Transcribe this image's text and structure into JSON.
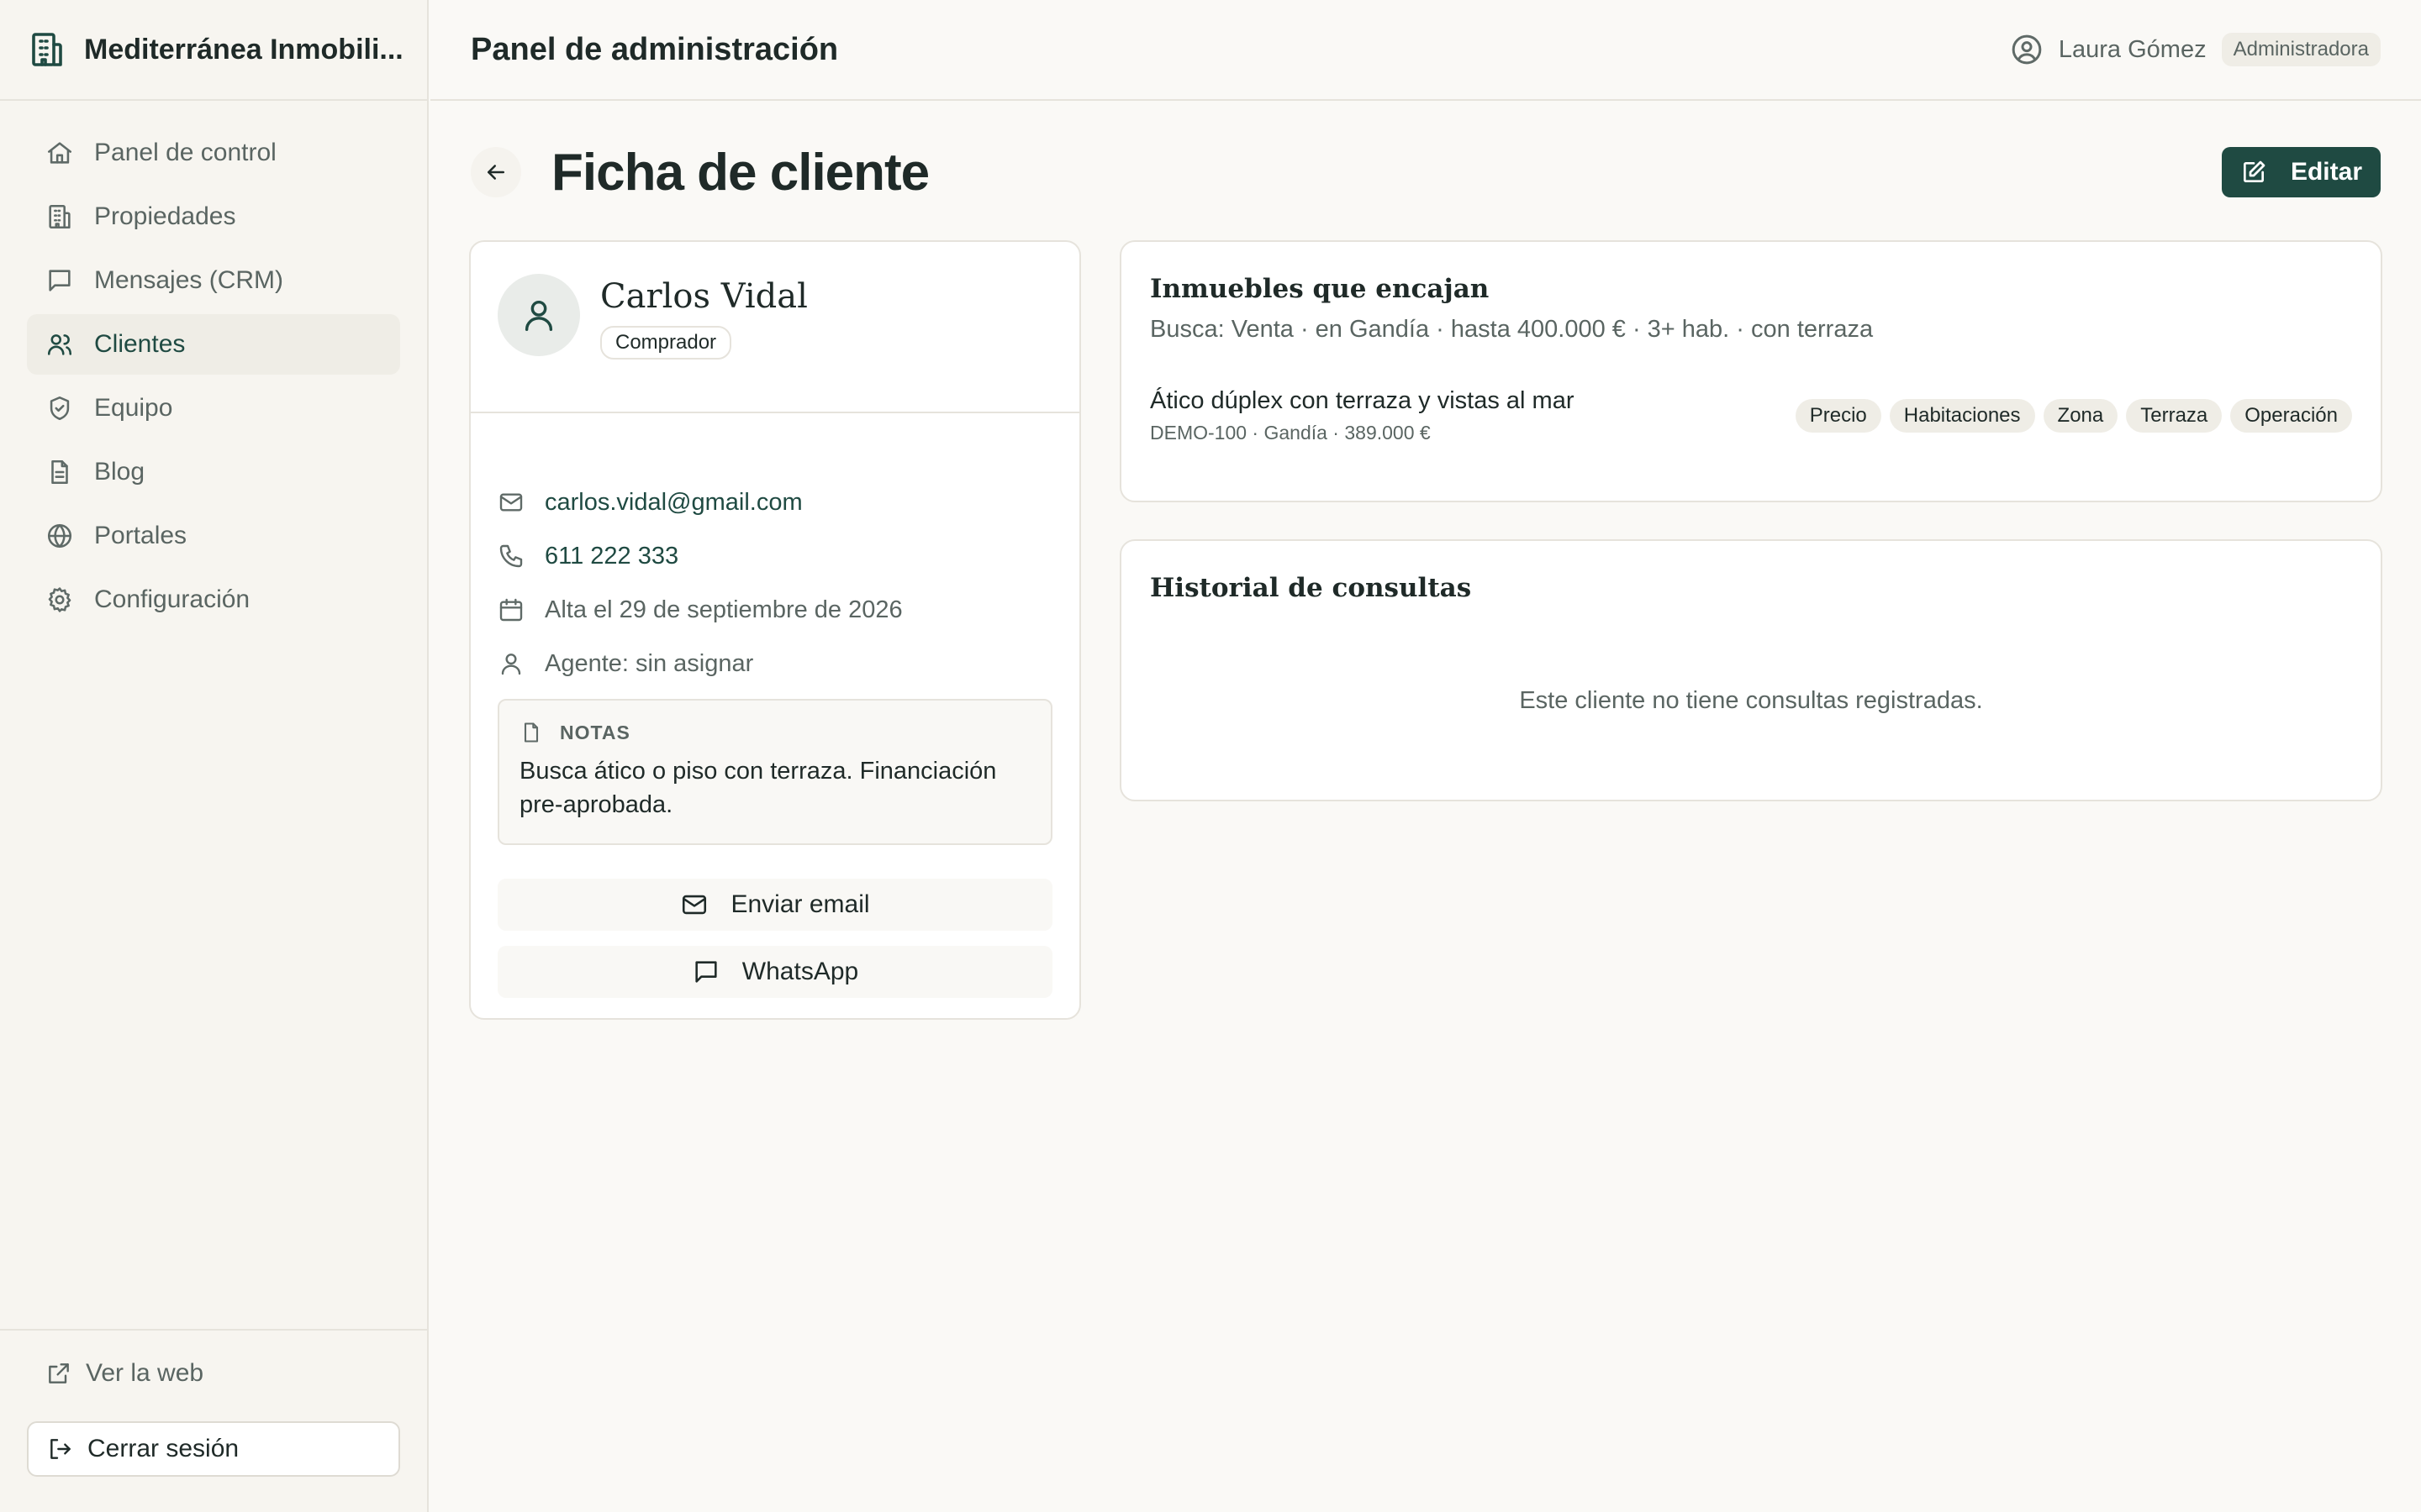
{
  "brand": {
    "name": "Mediterránea Inmobili..."
  },
  "header": {
    "title": "Panel de administración",
    "user_name": "Laura Gómez",
    "user_role": "Administradora"
  },
  "sidebar": {
    "items": [
      {
        "label": "Panel de control",
        "icon": "home-icon"
      },
      {
        "label": "Propiedades",
        "icon": "building-icon"
      },
      {
        "label": "Mensajes (CRM)",
        "icon": "message-icon"
      },
      {
        "label": "Clientes",
        "icon": "users-icon",
        "active": true
      },
      {
        "label": "Equipo",
        "icon": "shield-icon"
      },
      {
        "label": "Blog",
        "icon": "document-icon"
      },
      {
        "label": "Portales",
        "icon": "globe-icon"
      },
      {
        "label": "Configuración",
        "icon": "gear-icon"
      }
    ],
    "view_site": "Ver la web",
    "logout": "Cerrar sesión"
  },
  "page": {
    "title": "Ficha de cliente",
    "edit_label": "Editar"
  },
  "client": {
    "name": "Carlos Vidal",
    "type": "Comprador",
    "email": "carlos.vidal@gmail.com",
    "phone": "611 222 333",
    "since": "Alta el 29 de septiembre de 2026",
    "agent": "Agente: sin asignar",
    "notes_label": "NOTAS",
    "notes": "Busca ático o piso con terraza. Financiación pre-aprobada.",
    "send_email": "Enviar email",
    "whatsapp": "WhatsApp"
  },
  "matches": {
    "title": "Inmuebles que encajan",
    "criteria": "Busca: Venta · en Gandía · hasta 400.000 € · 3+ hab. · con terraza",
    "items": [
      {
        "title": "Ático dúplex con terraza y vistas al mar",
        "meta": "DEMO-100 · Gandía · 389.000 €",
        "tags": [
          "Precio",
          "Habitaciones",
          "Zona",
          "Terraza",
          "Operación"
        ]
      }
    ]
  },
  "history": {
    "title": "Historial de consultas",
    "empty": "Este cliente no tiene consultas registradas."
  },
  "colors": {
    "accent": "#1f4a42",
    "background": "#faf9f6",
    "border": "#e6e3dc"
  }
}
